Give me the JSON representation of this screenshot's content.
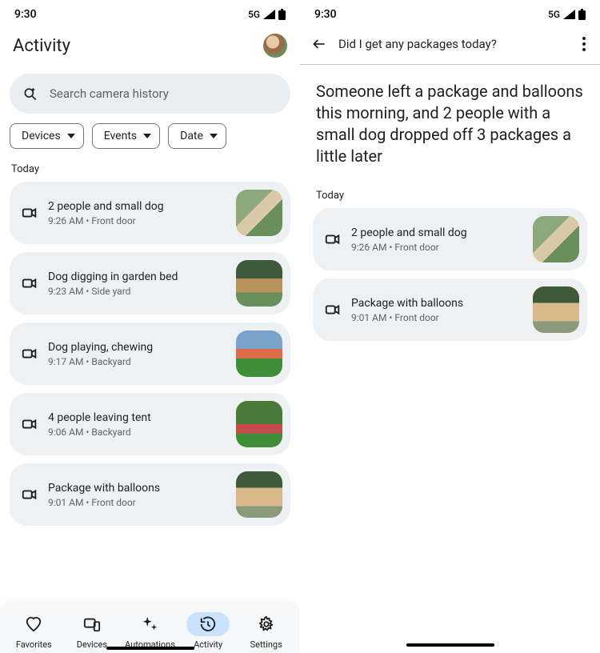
{
  "status": {
    "time": "9:30",
    "network": "5G"
  },
  "left": {
    "title": "Activity",
    "search_placeholder": "Search camera history",
    "chips": [
      {
        "label": "Devices"
      },
      {
        "label": "Events"
      },
      {
        "label": "Date"
      }
    ],
    "section": "Today",
    "events": [
      {
        "title": "2 people and small dog",
        "sub": "9:26 AM • Front door",
        "thumb": "t1"
      },
      {
        "title": "Dog digging in garden bed",
        "sub": "9:23 AM • Side yard",
        "thumb": "t2"
      },
      {
        "title": "Dog playing, chewing",
        "sub": "9:17 AM • Backyard",
        "thumb": "t3"
      },
      {
        "title": "4 people leaving tent",
        "sub": "9:06 AM • Backyard",
        "thumb": "t4"
      },
      {
        "title": "Package with balloons",
        "sub": "9:01 AM • Front door",
        "thumb": "t5"
      }
    ],
    "nav": {
      "favorites": "Favorites",
      "devices": "Devices",
      "automations": "Automations",
      "activity": "Activity",
      "settings": "Settings"
    }
  },
  "right": {
    "query": "Did I get any packages today?",
    "answer": "Someone left a package and balloons this morning, and 2 people with a small dog dropped off 3 packages a little later",
    "section": "Today",
    "events": [
      {
        "title": "2 people and small dog",
        "sub": "9:26 AM • Front door",
        "thumb": "t1"
      },
      {
        "title": "Package with balloons",
        "sub": "9:01 AM • Front door",
        "thumb": "t5"
      }
    ]
  }
}
